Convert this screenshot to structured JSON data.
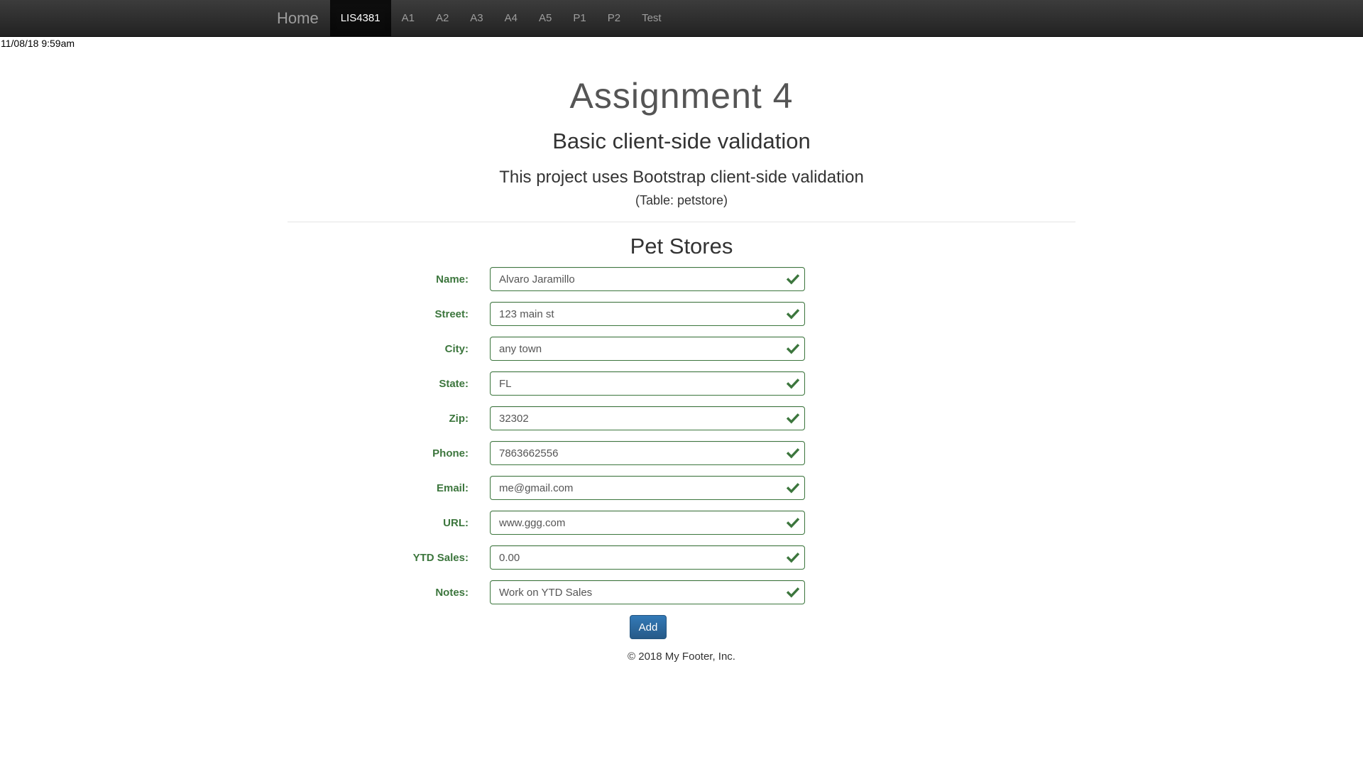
{
  "nav": {
    "brand": "Home",
    "items": [
      {
        "label": "LIS4381",
        "active": true
      },
      {
        "label": "A1"
      },
      {
        "label": "A2"
      },
      {
        "label": "A3"
      },
      {
        "label": "A4"
      },
      {
        "label": "A5"
      },
      {
        "label": "P1"
      },
      {
        "label": "P2"
      },
      {
        "label": "Test"
      }
    ]
  },
  "timestamp": "11/08/18 9:59am",
  "header": {
    "title": "Assignment 4",
    "subtitle": "Basic client-side validation",
    "description": "This project uses Bootstrap client-side validation",
    "table_note": "(Table: petstore)"
  },
  "form": {
    "title": "Pet Stores",
    "fields": [
      {
        "label": "Name:",
        "value": "Alvaro Jaramillo",
        "valid": true
      },
      {
        "label": "Street:",
        "value": "123 main st",
        "valid": true
      },
      {
        "label": "City:",
        "value": "any town",
        "valid": true
      },
      {
        "label": "State:",
        "value": "FL",
        "valid": true
      },
      {
        "label": "Zip:",
        "value": "32302",
        "valid": true
      },
      {
        "label": "Phone:",
        "value": "7863662556",
        "valid": true
      },
      {
        "label": "Email:",
        "value": "me@gmail.com",
        "valid": true
      },
      {
        "label": "URL:",
        "value": "www.ggg.com",
        "valid": true
      },
      {
        "label": "YTD Sales:",
        "value": "0.00",
        "valid": true
      },
      {
        "label": "Notes:",
        "value": "Work on YTD Sales",
        "valid": true
      }
    ],
    "submit_label": "Add"
  },
  "footer": "© 2018 My Footer, Inc.",
  "colors": {
    "navbar": "#222222",
    "valid": "#3c763d",
    "button": "#337ab7"
  },
  "icons": {
    "valid": "check-icon"
  }
}
